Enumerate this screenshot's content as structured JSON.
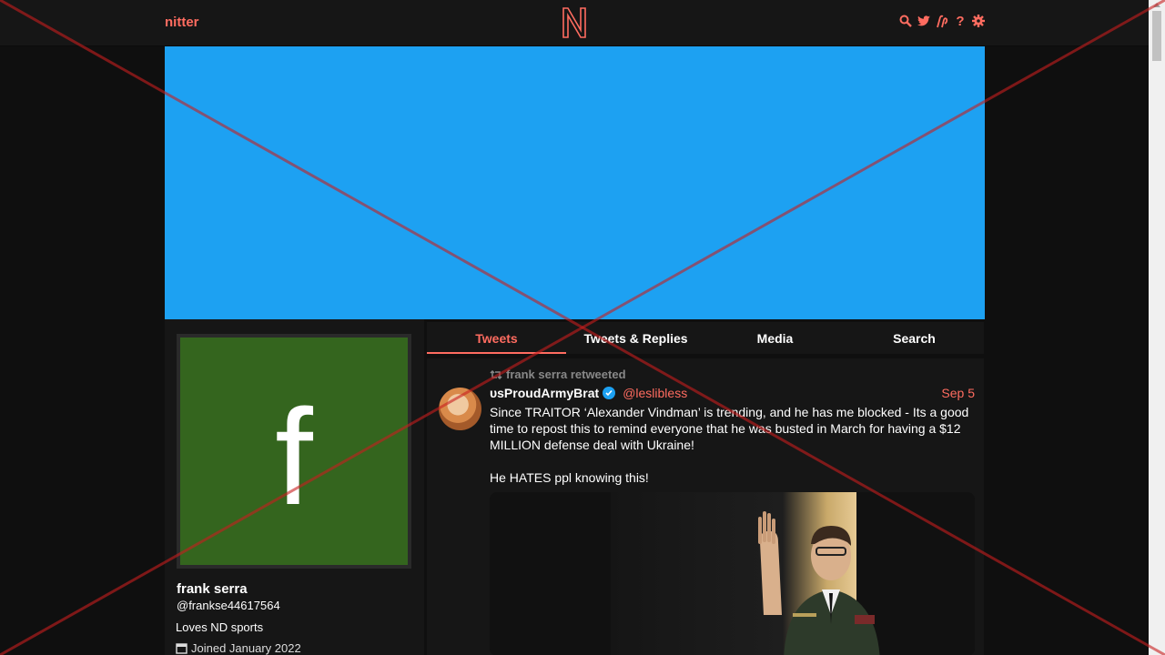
{
  "nav": {
    "brand": "nitter",
    "icons": [
      "search-icon",
      "bird-icon",
      "rss-icon",
      "help-icon",
      "gear-icon"
    ],
    "accent": "#ff6c60"
  },
  "banner": {
    "color": "#1da1f2"
  },
  "profile": {
    "fullname": "frank serra",
    "username": "@frankse44617564",
    "bio": "Loves ND sports",
    "joined": "Joined January 2022",
    "avatar_letter": "f",
    "avatar_color": "#34651e"
  },
  "tabs": [
    {
      "label": "Tweets",
      "active": true
    },
    {
      "label": "Tweets & Replies",
      "active": false
    },
    {
      "label": "Media",
      "active": false
    },
    {
      "label": "Search",
      "active": false
    }
  ],
  "tweet": {
    "retweet_label": "frank serra retweeted",
    "fullname": "ᴜsProudArmyBrat",
    "username": "@leslibless",
    "date": "Sep 5",
    "text_1": "Since TRAITOR ‘Alexander Vindman’ is trending, and he has me blocked - Its a good time to repost this to remind everyone that he was busted in March for having a $12 MILLION defense deal with Ukraine!",
    "text_2": "He HATES ppl knowing this!"
  }
}
